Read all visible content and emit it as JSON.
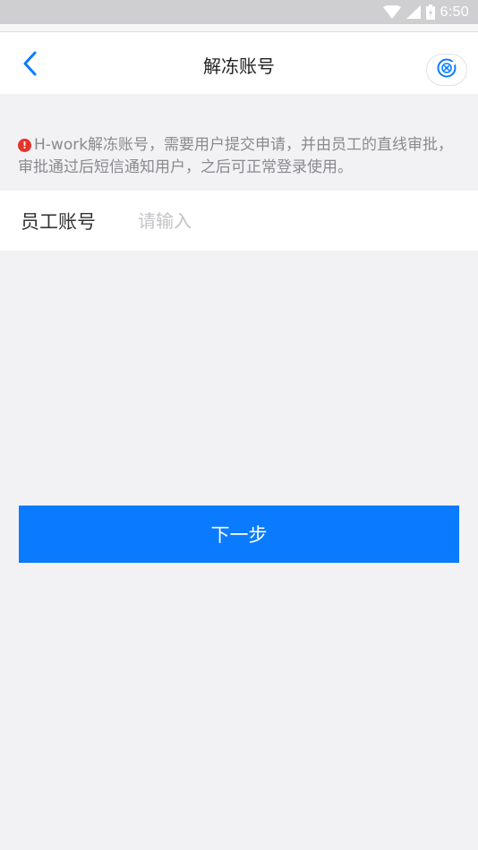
{
  "status_bar": {
    "time": "6:50",
    "icons": [
      "wifi-icon",
      "signal-icon",
      "battery-icon"
    ]
  },
  "nav": {
    "back_icon": "chevron-left-icon",
    "title": "解冻账号",
    "action_icon": "target-close-icon"
  },
  "notice": {
    "icon": "warning-icon",
    "icon_glyph": "!",
    "text": "H-work解冻账号，需要用户提交申请，并由员工的直线审批，审批通过后短信通知用户，之后可正常登录使用。"
  },
  "form": {
    "label": "员工账号",
    "value": "",
    "placeholder": "请输入"
  },
  "primary_button": {
    "label": "下一步"
  },
  "colors": {
    "accent": "#0a7bff",
    "warning": "#e5332a",
    "background": "#f2f2f4"
  }
}
